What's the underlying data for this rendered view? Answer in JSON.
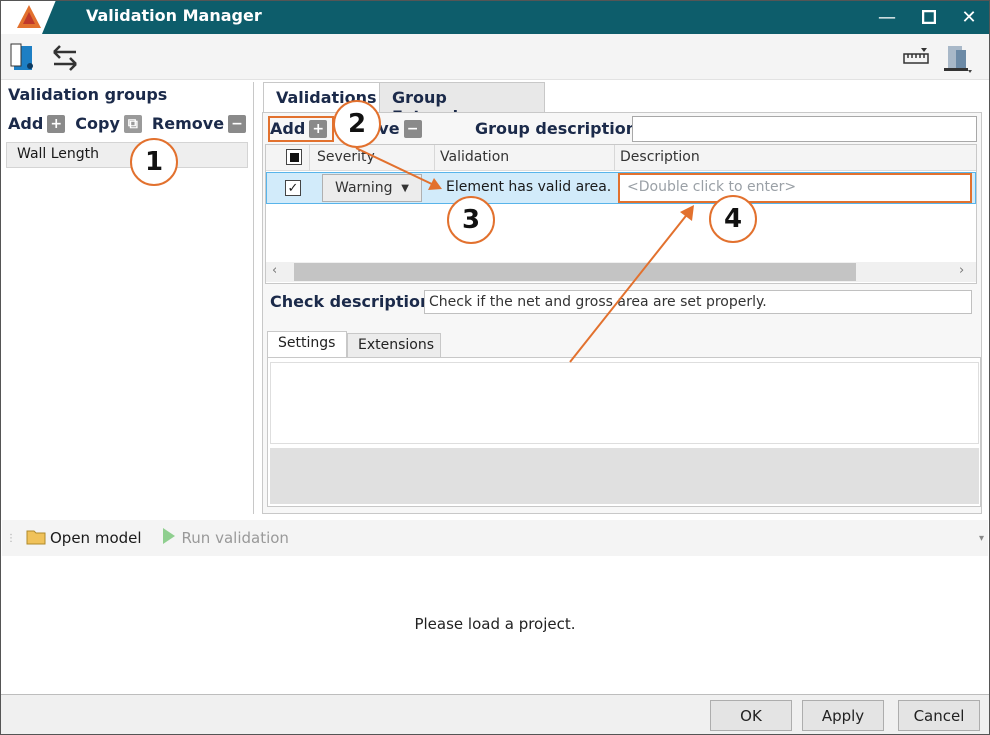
{
  "window": {
    "title": "Validation Manager",
    "minimize_glyph": "—",
    "maximize_glyph": "□",
    "close_glyph": "✕"
  },
  "toolbar": {
    "icons": [
      "model-file-icon",
      "swap-arrows-icon",
      "ruler-settings-icon",
      "building-icon"
    ]
  },
  "left": {
    "header": "Validation groups",
    "add": "Add",
    "copy": "Copy",
    "remove": "Remove",
    "groups": [
      "Wall Length"
    ]
  },
  "tabs": {
    "validations": "Validations",
    "group_extensions": "Group Extensions"
  },
  "validations": {
    "add": "Add",
    "remove_partial": "ove",
    "group_description_label": "Group description:",
    "group_description_value": "",
    "columns": {
      "severity": "Severity",
      "validation": "Validation",
      "description": "Description"
    },
    "rows": [
      {
        "severity": "Warning",
        "validation": "Element has valid area.",
        "description_placeholder": "<Double click to enter>"
      }
    ],
    "check_description_label": "Check description:",
    "check_description_value": "Check if the net and gross area are set properly."
  },
  "sub_tabs": {
    "settings": "Settings",
    "extensions": "Extensions"
  },
  "bottom": {
    "open_model": "Open model",
    "run_validation": "Run validation",
    "message": "Please load a project."
  },
  "buttons": {
    "ok": "OK",
    "apply": "Apply",
    "cancel": "Cancel"
  },
  "annotations": {
    "n1": "1",
    "n2": "2",
    "n3": "3",
    "n4": "4"
  },
  "colors": {
    "titlebar": "#0d5d6b",
    "annotation": "#e2712e",
    "selection": "#d2ebfa"
  }
}
